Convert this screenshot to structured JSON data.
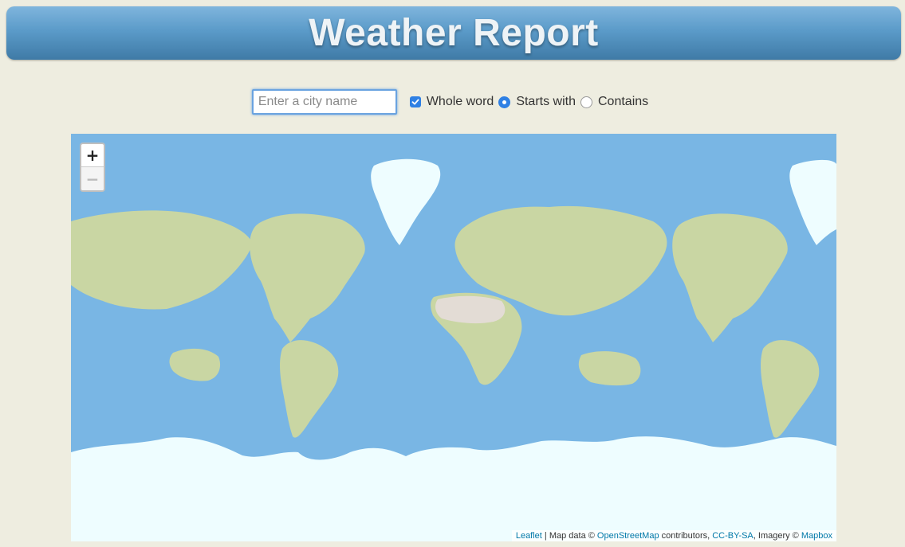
{
  "header": {
    "title": "Weather Report"
  },
  "search": {
    "placeholder": "Enter a city name",
    "value": ""
  },
  "options": {
    "whole_word": {
      "label": "Whole word",
      "checked": true
    },
    "match_mode": [
      {
        "label": "Starts with",
        "selected": true
      },
      {
        "label": "Contains",
        "selected": false
      }
    ]
  },
  "map": {
    "zoom_in": "+",
    "zoom_out": "−",
    "attribution": {
      "leaflet": "Leaflet",
      "sep1": " | Map data © ",
      "osm": "OpenStreetMap",
      "sep2": " contributors, ",
      "license": "CC-BY-SA",
      "sep3": ", Imagery © ",
      "mapbox": "Mapbox"
    },
    "colors": {
      "ocean": "#79b6e4",
      "land": "#c9d6a3",
      "ice": "#eefdff",
      "desert": "#e3dcd5"
    }
  }
}
